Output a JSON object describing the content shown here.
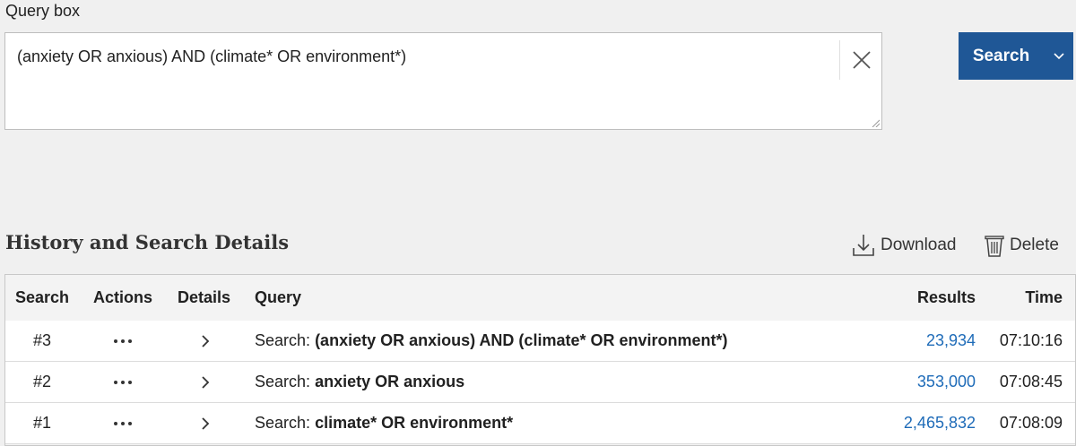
{
  "query": {
    "label": "Query box",
    "value": "(anxiety OR anxious) AND (climate* OR environment*)",
    "clear_icon": "close-icon"
  },
  "search_button": {
    "label": "Search",
    "caret_icon": "chevron-down-icon",
    "color": "#1f5796"
  },
  "history": {
    "title": "History and Search Details",
    "download_label": "Download",
    "delete_label": "Delete",
    "columns": {
      "search": "Search",
      "actions": "Actions",
      "details": "Details",
      "query": "Query",
      "results": "Results",
      "time": "Time"
    },
    "rows": [
      {
        "num": "#3",
        "prefix": "Search:",
        "query": "(anxiety OR anxious) AND (climate* OR environment*)",
        "results": "23,934",
        "time": "07:10:16"
      },
      {
        "num": "#2",
        "prefix": "Search:",
        "query": "anxiety OR anxious",
        "results": "353,000",
        "time": "07:08:45"
      },
      {
        "num": "#1",
        "prefix": "Search:",
        "query": "climate* OR environment*",
        "results": "2,465,832",
        "time": "07:08:09"
      }
    ]
  },
  "colors": {
    "link": "#1e6bb8",
    "background": "#f0f0f0"
  }
}
